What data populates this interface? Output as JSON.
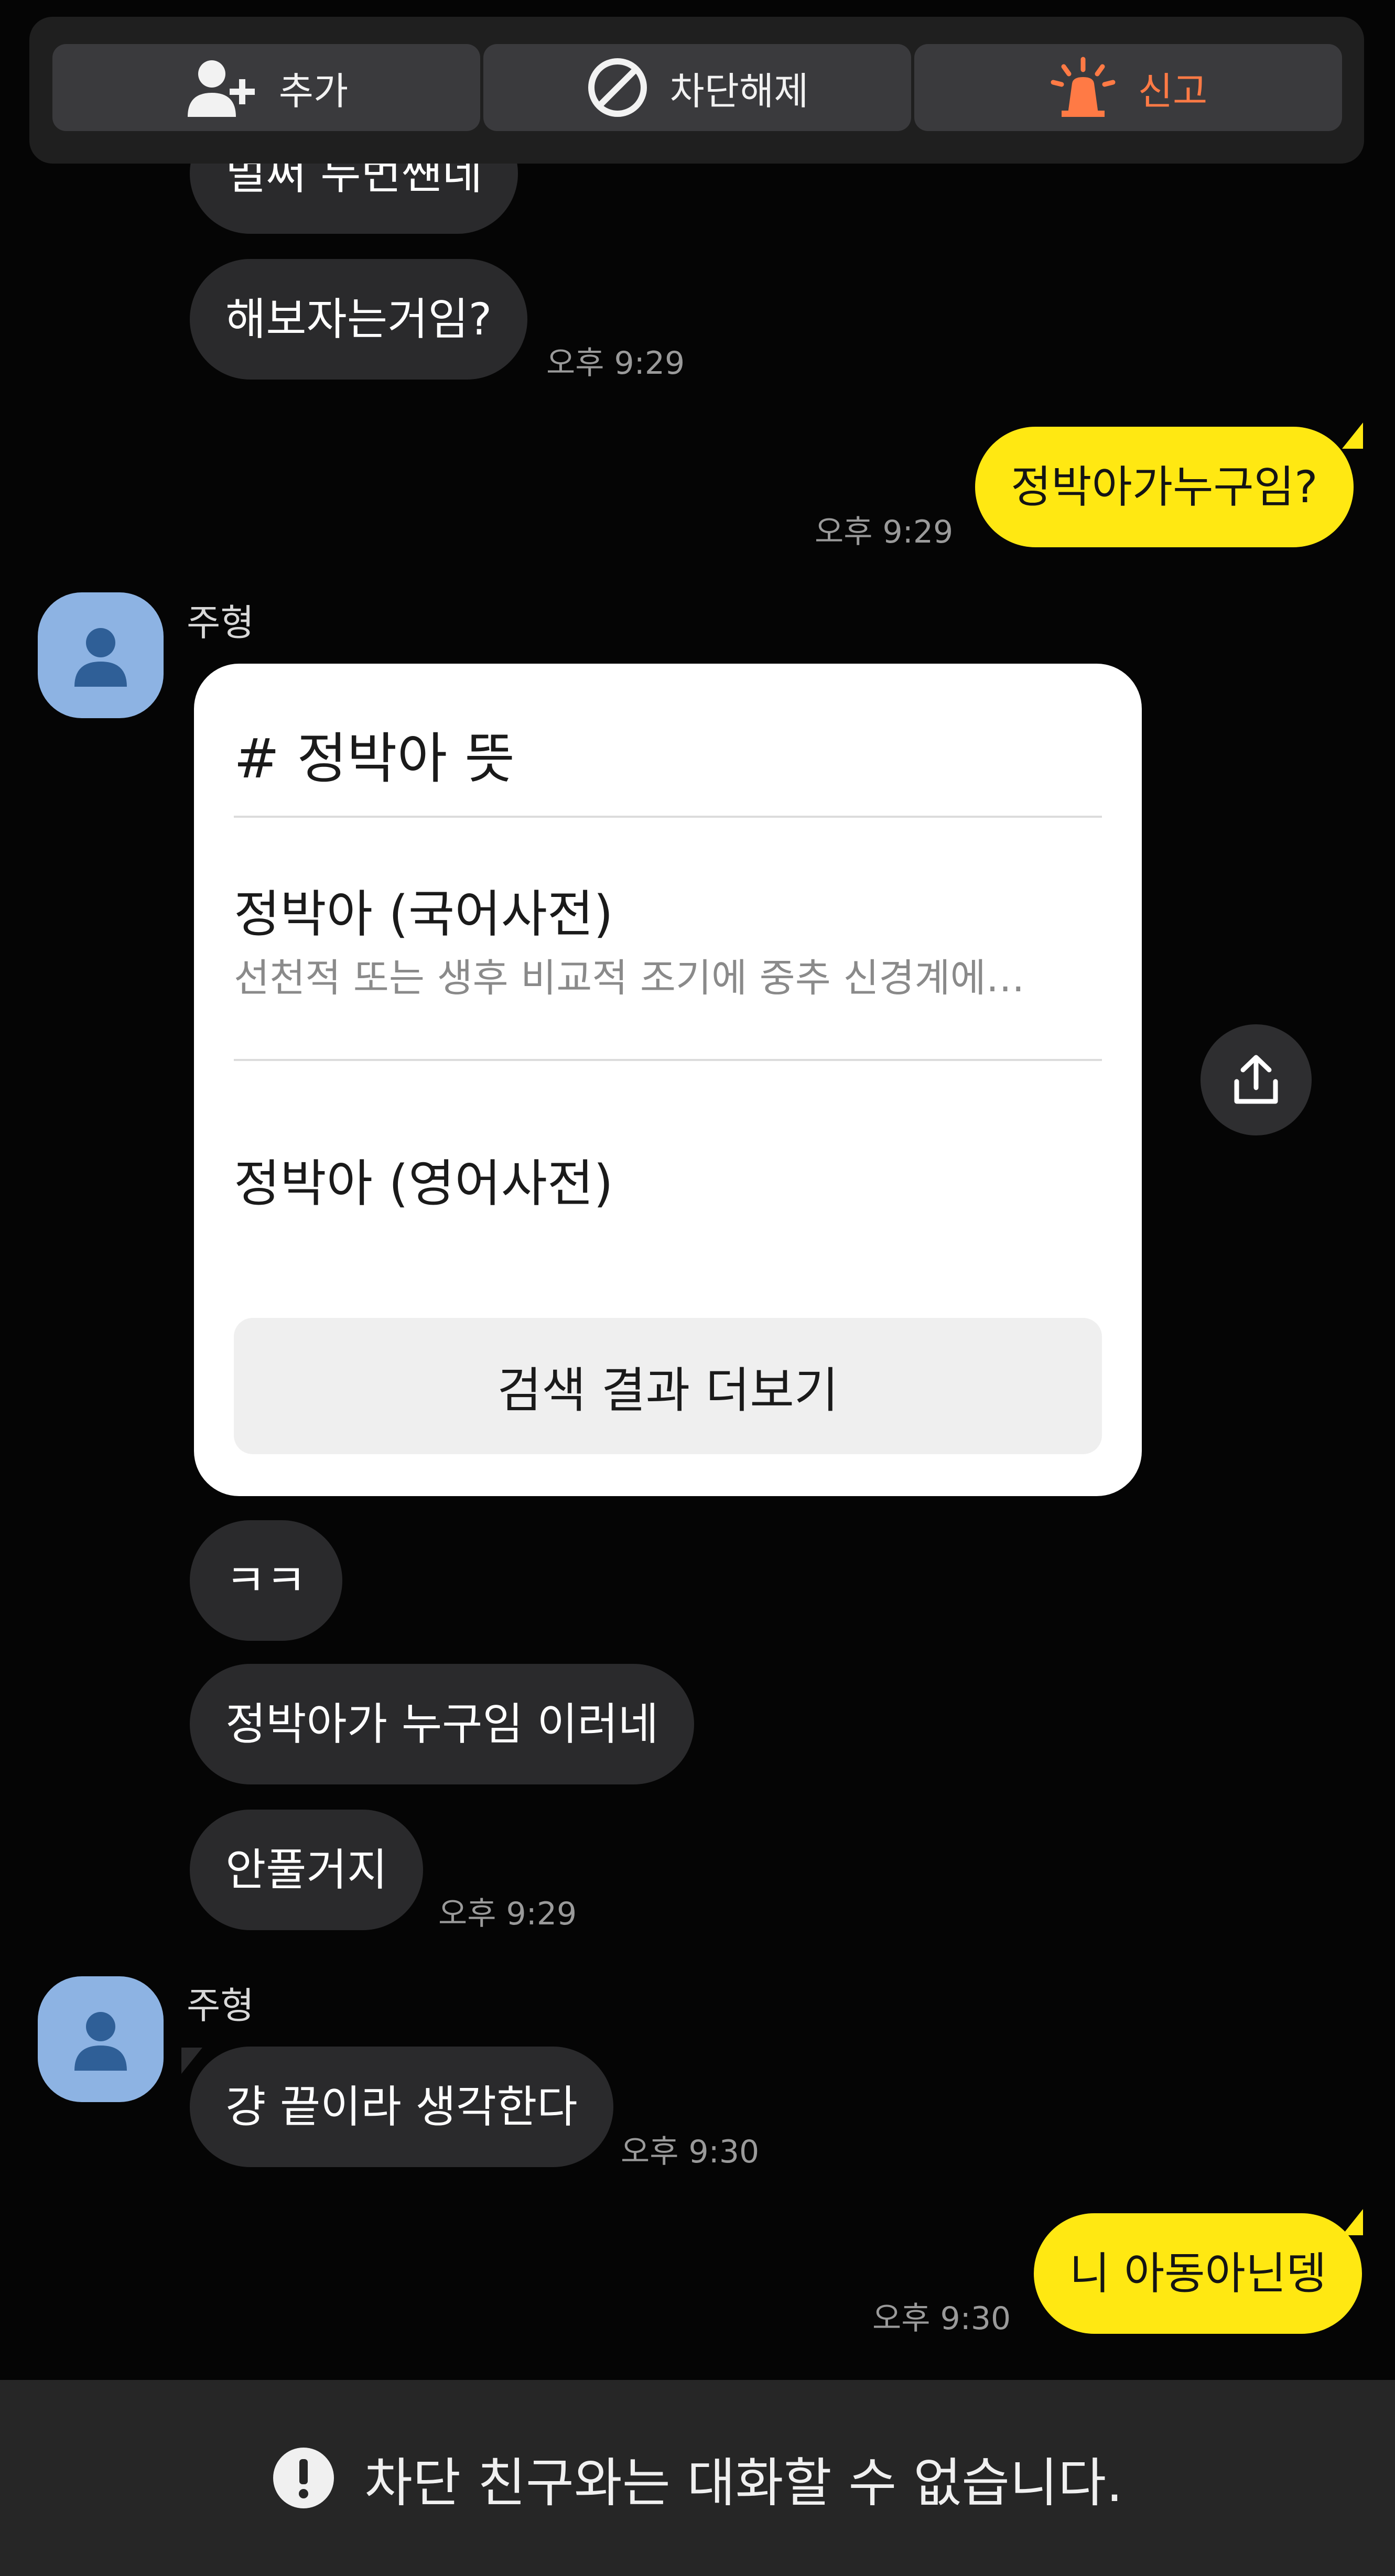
{
  "toolbar": {
    "add_label": "추가",
    "unblock_label": "차단해제",
    "report_label": "신고"
  },
  "colors": {
    "incoming_bubble": "#2a2a2c",
    "outgoing_bubble": "#ffe812",
    "report_accent": "#ff7a45",
    "avatar": "#8db3e3"
  },
  "messages": {
    "m0": "벌써 두번쨴네",
    "m1": "해보자는거임?",
    "m1_time": "오후 9:29",
    "m2": "정박아가누구임?",
    "m2_time": "오후 9:29",
    "sender1": "주형",
    "m4": "ㅋㅋ",
    "m5": "정박아가 누구임 이러네",
    "m6": "안풀거지",
    "m6_time": "오후 9:29",
    "sender2": "주형",
    "m7": "걍 끝이라 생각한다",
    "m7_time": "오후 9:30",
    "m8": "니 아동아닌뎅",
    "m8_time": "오후 9:30"
  },
  "card": {
    "title": "# 정박아 뜻",
    "entry1_title": "정박아 (국어사전)",
    "entry1_desc": "선천적 또는 생후 비교적 조기에 중추 신경계에…",
    "entry2_title": "정박아 (영어사전)",
    "more_button": "검색 결과 더보기"
  },
  "footer": {
    "blocked_message": "차단 친구와는 대화할 수 없습니다."
  }
}
